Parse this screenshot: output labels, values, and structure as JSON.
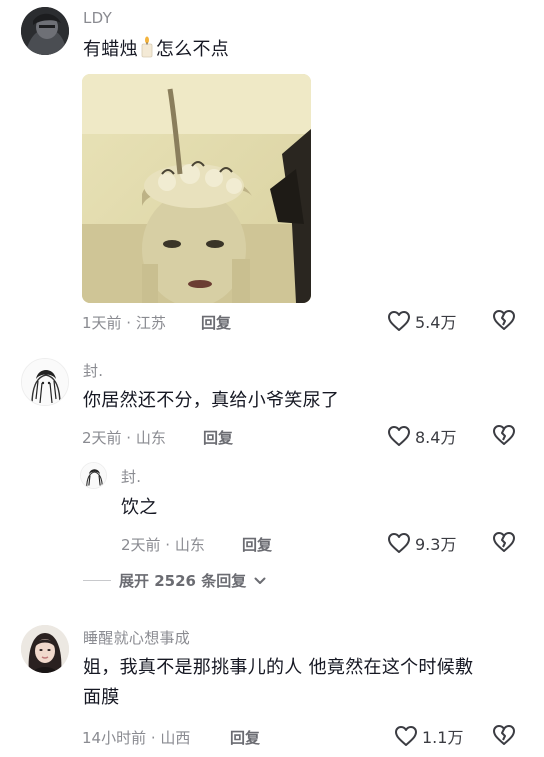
{
  "comments": [
    {
      "user": "LDY",
      "text_before": "有蜡烛",
      "text_after": "怎么不点",
      "time_location": "1天前 · 江苏",
      "reply_label": "回复",
      "likes": "5.4万",
      "has_image": true
    },
    {
      "user": "封.",
      "text": "你居然还不分，真给小爷笑尿了",
      "time_location": "2天前 · 山东",
      "reply_label": "回复",
      "likes": "8.4万",
      "replies": [
        {
          "user": "封.",
          "text": "饮之",
          "time_location": "2天前 · 山东",
          "reply_label": "回复",
          "likes": "9.3万"
        }
      ],
      "expand_label": "展开 2526 条回复"
    },
    {
      "user": "睡醒就心想事成",
      "text_line1": "姐，我真不是那挑事儿的人 他竟然在这个时候敷",
      "text_line2": "面膜",
      "time_location": "14小时前 · 山西",
      "reply_label": "回复",
      "likes": "1.1万"
    }
  ],
  "icons": {
    "like": "heart-outline-icon",
    "dislike": "broken-heart-icon",
    "expand": "chevron-down-icon",
    "candle": "candle-emoji-icon"
  },
  "colors": {
    "text": "#161823",
    "muted": "#8a8b91",
    "icon": "#3b3c42"
  }
}
